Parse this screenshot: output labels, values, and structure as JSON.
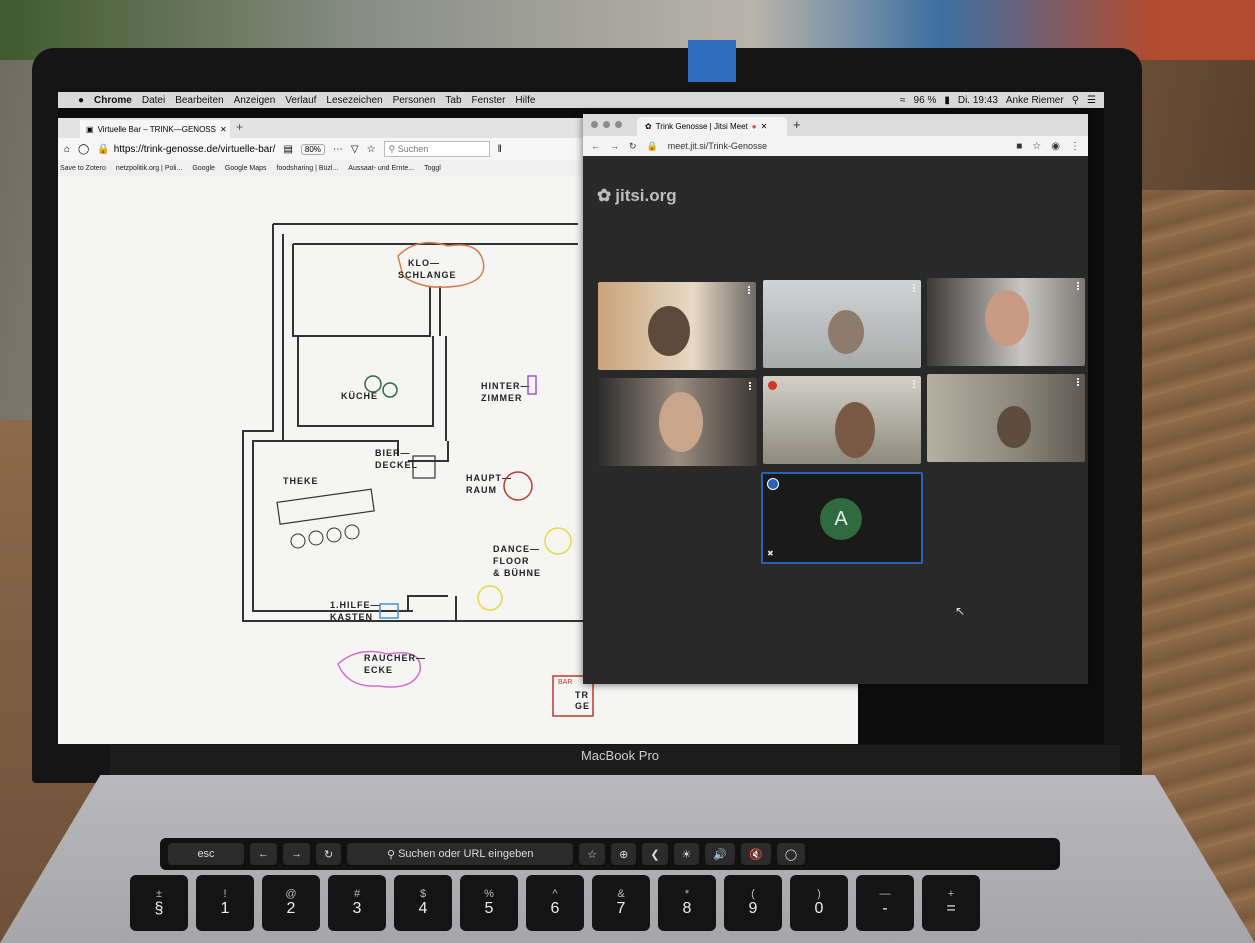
{
  "laptop": {
    "model_label": "MacBook Pro"
  },
  "menubar": {
    "apple": "",
    "app": "Chrome",
    "items": [
      "Datei",
      "Bearbeiten",
      "Anzeigen",
      "Verlauf",
      "Lesezeichen",
      "Personen",
      "Tab",
      "Fenster",
      "Hilfe"
    ],
    "battery": "96 %",
    "clock": "Di. 19:43",
    "user": "Anke Riemer"
  },
  "firefox": {
    "tab_title": "Virtuelle Bar – TRINK—GENOSS",
    "url": "https://trink-genosse.de/virtuelle-bar/",
    "zoom": "80%",
    "search_placeholder": "Suchen",
    "bookmarks": [
      "Save to Zotero",
      "netzpolitik.org | Poli...",
      "Google",
      "Google Maps",
      "foodsharing | Büzl...",
      "Aussaat- und Ernte...",
      "Toggl"
    ]
  },
  "floorplan": {
    "rooms": {
      "klo": "KLO—",
      "klo2": "SCHLANGE",
      "kueche": "KÜCHE",
      "hinter": "HINTER—",
      "hinter2": "ZIMMER",
      "bier": "BIER—",
      "bier2": "DECKEL",
      "theke": "THEKE",
      "haupt": "HAUPT—",
      "haupt2": "RAUM",
      "dance": "DANCE—",
      "dance2": "FLOOR",
      "dance3": "& BÜHNE",
      "hilfe": "1.HILFE—",
      "hilfe2": "KASTEN",
      "raucher": "RAUCHER—",
      "raucher2": "ECKE",
      "bar_sign": "BAR",
      "partial": "TR",
      "partial2": "GE"
    }
  },
  "chrome": {
    "tab_title": "Trink Genosse | Jitsi Meet",
    "url": "meet.jit.si/Trink-Genosse"
  },
  "jitsi": {
    "logo": "jitsi.org",
    "avatar_initial": "A",
    "participant_count": 7
  },
  "touchbar": {
    "esc": "esc",
    "search": "Suchen oder URL eingeben"
  },
  "keys": [
    {
      "top": "±",
      "bottom": "§"
    },
    {
      "top": "!",
      "bottom": "1"
    },
    {
      "top": "@",
      "bottom": "2"
    },
    {
      "top": "#",
      "bottom": "3"
    },
    {
      "top": "$",
      "bottom": "4"
    },
    {
      "top": "%",
      "bottom": "5"
    },
    {
      "top": "^",
      "bottom": "6"
    },
    {
      "top": "&",
      "bottom": "7"
    },
    {
      "top": "*",
      "bottom": "8"
    },
    {
      "top": "(",
      "bottom": "9"
    },
    {
      "top": ")",
      "bottom": "0"
    },
    {
      "top": "—",
      "bottom": "-"
    },
    {
      "top": "+",
      "bottom": "="
    }
  ],
  "colors": {
    "jitsi_bg": "#292929",
    "active_border": "#2a62b5",
    "avatar_bg": "#2e6b3f",
    "tape": "#2f6fbf"
  }
}
